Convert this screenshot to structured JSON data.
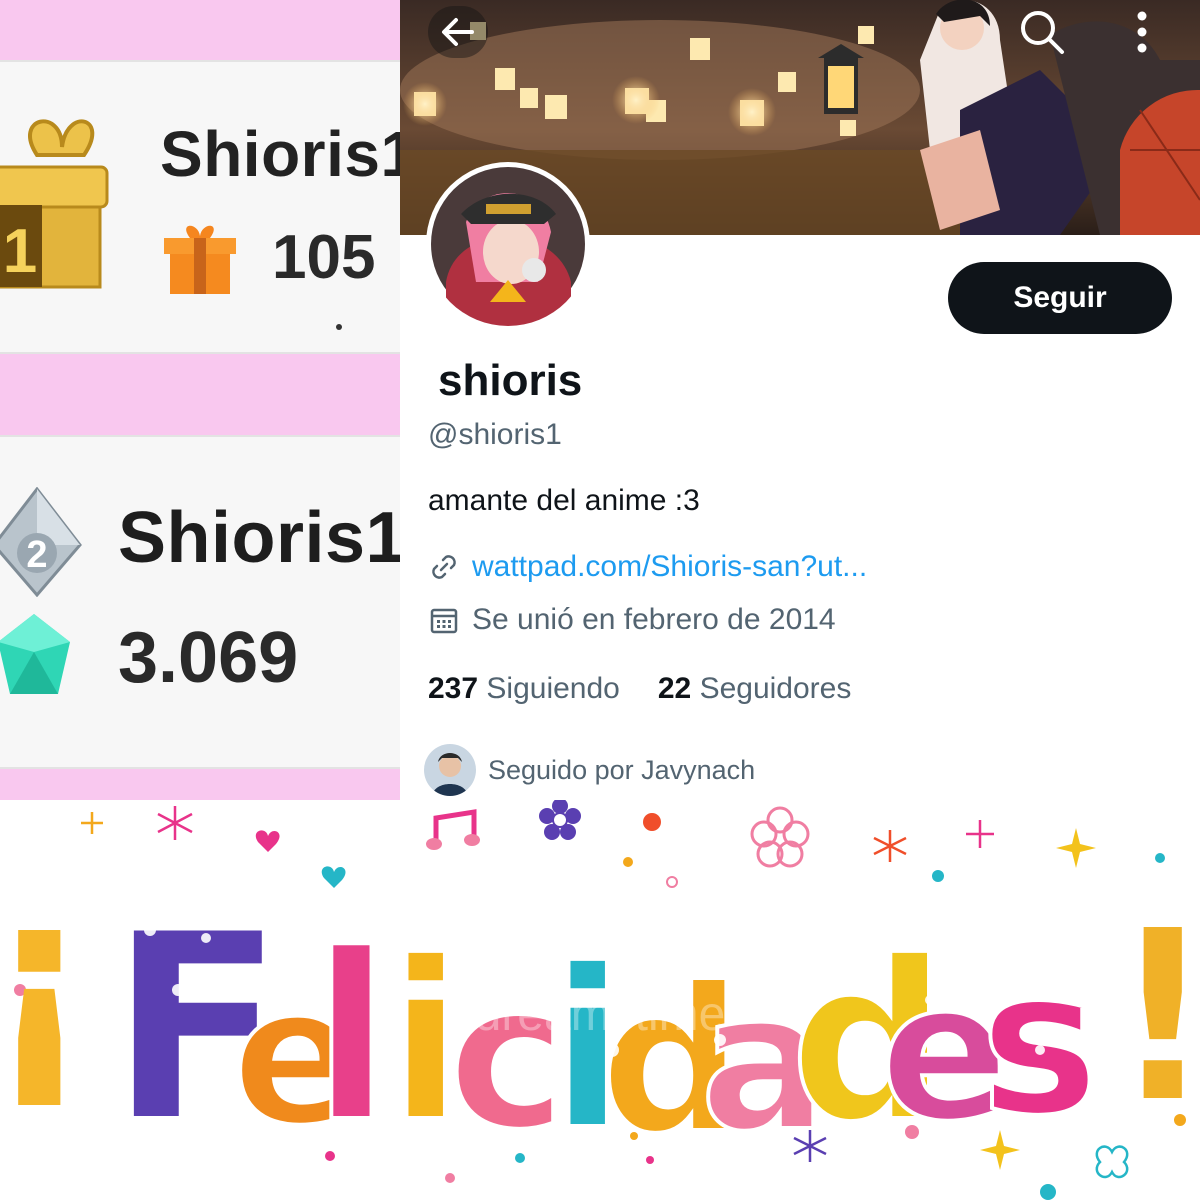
{
  "left_panel": {
    "rank_1": {
      "place": "1",
      "name": "Shioris1",
      "count": "105",
      "icon": "gift-box-icon",
      "count_icon": "orange-gift-icon"
    },
    "rank_2": {
      "place": "2",
      "name": "Shioris1",
      "count": "3.069",
      "icon": "silver-gem-badge-icon",
      "count_icon": "teal-diamond-icon"
    },
    "colors": {
      "background": "#f9c8ef",
      "card": "#f7f7f7",
      "gold": "#e2b43c",
      "teal": "#2fd6b5"
    }
  },
  "profile": {
    "display_name": "shioris",
    "handle": "@shioris1",
    "bio": "amante del anime :3",
    "link": "wattpad.com/Shioris-san?ut...",
    "joined": "Se unió en febrero de 2014",
    "following_count": "237",
    "following_label": "Siguiendo",
    "followers_count": "22",
    "followers_label": "Seguidores",
    "followed_by": "Seguido por Javynach",
    "follow_button": "Seguir",
    "icons": {
      "back": "back-arrow-icon",
      "search": "search-icon",
      "more": "more-vertical-icon",
      "link": "link-icon",
      "calendar": "calendar-icon"
    },
    "colors": {
      "text": "#0f1419",
      "secondary": "#536471",
      "link": "#1d9bf0",
      "button": "#0f1419"
    }
  },
  "congrats": {
    "text": "¡Felicidades!",
    "watermark": "dreamstime",
    "letter_colors": [
      "#f5b62a",
      "#5a3fb1",
      "#f08a1c",
      "#e8408a",
      "#f4b51b",
      "#f06a8e",
      "#25b6c7",
      "#f3a81c",
      "#f07ea2",
      "#f0c61c",
      "#d84c9c",
      "#e8338a",
      "#f0b128"
    ]
  }
}
